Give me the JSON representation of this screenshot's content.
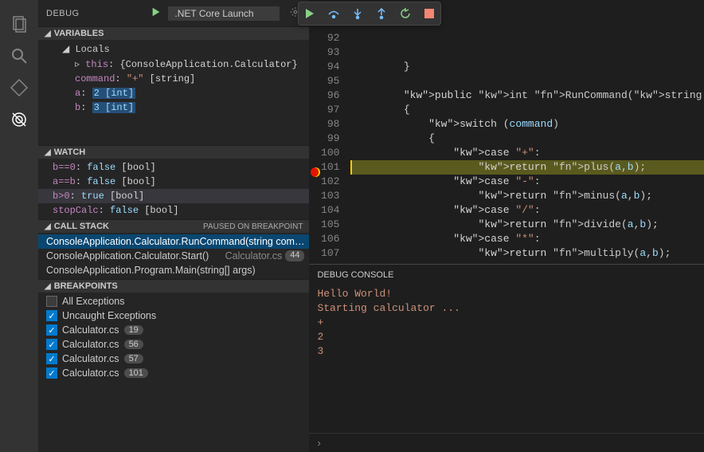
{
  "activity": {
    "items": [
      "explorer",
      "search",
      "scm",
      "debug"
    ]
  },
  "debugHeader": {
    "title": "DEBUG",
    "config": ".NET Core Launch"
  },
  "variables": {
    "title": "VARIABLES",
    "localsLabel": "Locals",
    "items": [
      {
        "name": "this",
        "prefix": "▹ ",
        "value": "{ConsoleApplication.Calculator}"
      },
      {
        "name": "command",
        "value": "\"+\"",
        "type": "[string]"
      },
      {
        "name": "a",
        "value": "2",
        "type": "[int]",
        "hl": true
      },
      {
        "name": "b",
        "value": "3",
        "type": "[int]",
        "hl": true
      }
    ]
  },
  "watch": {
    "title": "WATCH",
    "items": [
      {
        "expr": "b==0",
        "value": "false",
        "type": "[bool]"
      },
      {
        "expr": "a==b",
        "value": "false",
        "type": "[bool]"
      },
      {
        "expr": "b>0",
        "value": "true",
        "type": "[bool]",
        "selected": true
      },
      {
        "expr": "stopCalc",
        "value": "false",
        "type": "[bool]"
      }
    ]
  },
  "callstack": {
    "title": "CALL STACK",
    "status": "PAUSED ON BREAKPOINT",
    "frames": [
      {
        "func": "ConsoleApplication.Calculator.RunCommand(string com…",
        "file": "",
        "line": "",
        "selected": true
      },
      {
        "func": "ConsoleApplication.Calculator.Start()",
        "file": "Calculator.cs",
        "line": "44"
      },
      {
        "func": "ConsoleApplication.Program.Main(string[] args)",
        "file": "",
        "line": ""
      }
    ]
  },
  "breakpoints": {
    "title": "BREAKPOINTS",
    "items": [
      {
        "label": "All Exceptions",
        "checked": false
      },
      {
        "label": "Uncaught Exceptions",
        "checked": true
      },
      {
        "label": "Calculator.cs",
        "checked": true,
        "line": "19"
      },
      {
        "label": "Calculator.cs",
        "checked": true,
        "line": "56"
      },
      {
        "label": "Calculator.cs",
        "checked": true,
        "line": "57"
      },
      {
        "label": "Calculator.cs",
        "checked": true,
        "line": "101"
      }
    ]
  },
  "editor": {
    "lines": [
      {
        "n": 92,
        "t": ""
      },
      {
        "n": 93,
        "t": ""
      },
      {
        "n": 94,
        "t": "        }"
      },
      {
        "n": 95,
        "t": ""
      },
      {
        "n": 96,
        "t": "        public int RunCommand(string command, int a , int b"
      },
      {
        "n": 97,
        "t": "        {"
      },
      {
        "n": 98,
        "t": "            switch (command)"
      },
      {
        "n": 99,
        "t": "            {"
      },
      {
        "n": 100,
        "t": "                case \"+\":"
      },
      {
        "n": 101,
        "t": "                    return plus(a,b);",
        "hl": true,
        "bp": true
      },
      {
        "n": 102,
        "t": "                case \"-\":"
      },
      {
        "n": 103,
        "t": "                    return minus(a,b);"
      },
      {
        "n": 104,
        "t": "                case \"/\":"
      },
      {
        "n": 105,
        "t": "                    return divide(a,b);"
      },
      {
        "n": 106,
        "t": "                case \"*\":"
      },
      {
        "n": 107,
        "t": "                    return multiply(a,b);"
      }
    ]
  },
  "panel": {
    "title": "DEBUG CONSOLE",
    "output": [
      "Hello World!",
      "Starting calculator ...",
      "+",
      "2",
      "3"
    ],
    "prompt": "›"
  }
}
